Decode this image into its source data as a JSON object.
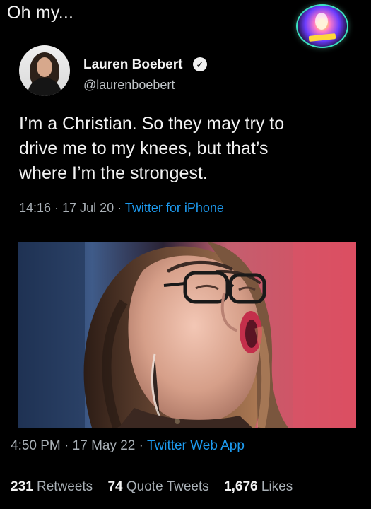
{
  "caption": "Oh my...",
  "watermark": {
    "icon": "colorful-circle-watermark"
  },
  "tweet": {
    "author_name": "Lauren Boebert",
    "handle": "@laurenboebert",
    "text": "I’m a Christian. So they may try to\ndrive me to my knees, but that’s\nwhere I’m the strongest.",
    "time": "14:16",
    "date": "17 Jul 20",
    "source": "Twitter for iPhone",
    "verified_icon": "verified-icon",
    "colors": {
      "link": "#1d9bf0",
      "muted": "#aab1b7"
    }
  },
  "photo": {
    "subject": "woman with long brown hair, glasses, mouth open"
  },
  "quote_meta": {
    "time": "4:50 PM",
    "date": "17 May 22",
    "source": "Twitter Web App"
  },
  "stats": {
    "retweets_count": "231",
    "retweets_label": "Retweets",
    "quote_tweets_count": "74",
    "quote_tweets_label": "Quote Tweets",
    "likes_count": "1,676",
    "likes_label": "Likes"
  }
}
